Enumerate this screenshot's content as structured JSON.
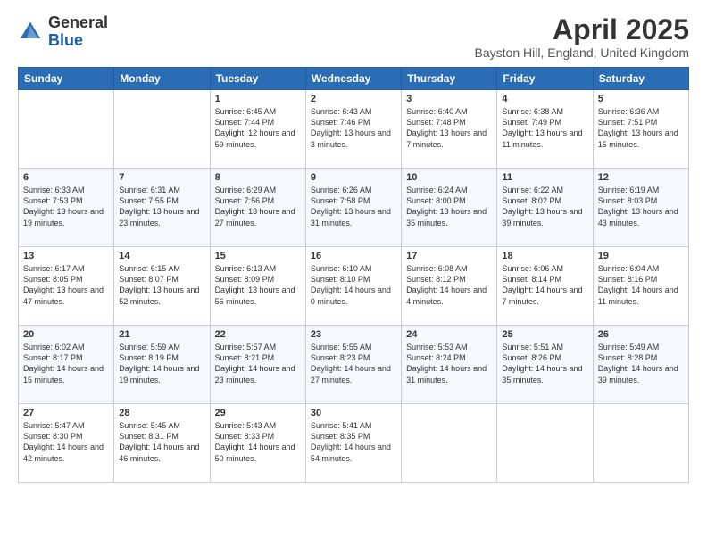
{
  "header": {
    "logo_general": "General",
    "logo_blue": "Blue",
    "month_title": "April 2025",
    "location": "Bayston Hill, England, United Kingdom"
  },
  "days_of_week": [
    "Sunday",
    "Monday",
    "Tuesday",
    "Wednesday",
    "Thursday",
    "Friday",
    "Saturday"
  ],
  "weeks": [
    [
      {
        "day": "",
        "info": ""
      },
      {
        "day": "",
        "info": ""
      },
      {
        "day": "1",
        "info": "Sunrise: 6:45 AM\nSunset: 7:44 PM\nDaylight: 12 hours and 59 minutes."
      },
      {
        "day": "2",
        "info": "Sunrise: 6:43 AM\nSunset: 7:46 PM\nDaylight: 13 hours and 3 minutes."
      },
      {
        "day": "3",
        "info": "Sunrise: 6:40 AM\nSunset: 7:48 PM\nDaylight: 13 hours and 7 minutes."
      },
      {
        "day": "4",
        "info": "Sunrise: 6:38 AM\nSunset: 7:49 PM\nDaylight: 13 hours and 11 minutes."
      },
      {
        "day": "5",
        "info": "Sunrise: 6:36 AM\nSunset: 7:51 PM\nDaylight: 13 hours and 15 minutes."
      }
    ],
    [
      {
        "day": "6",
        "info": "Sunrise: 6:33 AM\nSunset: 7:53 PM\nDaylight: 13 hours and 19 minutes."
      },
      {
        "day": "7",
        "info": "Sunrise: 6:31 AM\nSunset: 7:55 PM\nDaylight: 13 hours and 23 minutes."
      },
      {
        "day": "8",
        "info": "Sunrise: 6:29 AM\nSunset: 7:56 PM\nDaylight: 13 hours and 27 minutes."
      },
      {
        "day": "9",
        "info": "Sunrise: 6:26 AM\nSunset: 7:58 PM\nDaylight: 13 hours and 31 minutes."
      },
      {
        "day": "10",
        "info": "Sunrise: 6:24 AM\nSunset: 8:00 PM\nDaylight: 13 hours and 35 minutes."
      },
      {
        "day": "11",
        "info": "Sunrise: 6:22 AM\nSunset: 8:02 PM\nDaylight: 13 hours and 39 minutes."
      },
      {
        "day": "12",
        "info": "Sunrise: 6:19 AM\nSunset: 8:03 PM\nDaylight: 13 hours and 43 minutes."
      }
    ],
    [
      {
        "day": "13",
        "info": "Sunrise: 6:17 AM\nSunset: 8:05 PM\nDaylight: 13 hours and 47 minutes."
      },
      {
        "day": "14",
        "info": "Sunrise: 6:15 AM\nSunset: 8:07 PM\nDaylight: 13 hours and 52 minutes."
      },
      {
        "day": "15",
        "info": "Sunrise: 6:13 AM\nSunset: 8:09 PM\nDaylight: 13 hours and 56 minutes."
      },
      {
        "day": "16",
        "info": "Sunrise: 6:10 AM\nSunset: 8:10 PM\nDaylight: 14 hours and 0 minutes."
      },
      {
        "day": "17",
        "info": "Sunrise: 6:08 AM\nSunset: 8:12 PM\nDaylight: 14 hours and 4 minutes."
      },
      {
        "day": "18",
        "info": "Sunrise: 6:06 AM\nSunset: 8:14 PM\nDaylight: 14 hours and 7 minutes."
      },
      {
        "day": "19",
        "info": "Sunrise: 6:04 AM\nSunset: 8:16 PM\nDaylight: 14 hours and 11 minutes."
      }
    ],
    [
      {
        "day": "20",
        "info": "Sunrise: 6:02 AM\nSunset: 8:17 PM\nDaylight: 14 hours and 15 minutes."
      },
      {
        "day": "21",
        "info": "Sunrise: 5:59 AM\nSunset: 8:19 PM\nDaylight: 14 hours and 19 minutes."
      },
      {
        "day": "22",
        "info": "Sunrise: 5:57 AM\nSunset: 8:21 PM\nDaylight: 14 hours and 23 minutes."
      },
      {
        "day": "23",
        "info": "Sunrise: 5:55 AM\nSunset: 8:23 PM\nDaylight: 14 hours and 27 minutes."
      },
      {
        "day": "24",
        "info": "Sunrise: 5:53 AM\nSunset: 8:24 PM\nDaylight: 14 hours and 31 minutes."
      },
      {
        "day": "25",
        "info": "Sunrise: 5:51 AM\nSunset: 8:26 PM\nDaylight: 14 hours and 35 minutes."
      },
      {
        "day": "26",
        "info": "Sunrise: 5:49 AM\nSunset: 8:28 PM\nDaylight: 14 hours and 39 minutes."
      }
    ],
    [
      {
        "day": "27",
        "info": "Sunrise: 5:47 AM\nSunset: 8:30 PM\nDaylight: 14 hours and 42 minutes."
      },
      {
        "day": "28",
        "info": "Sunrise: 5:45 AM\nSunset: 8:31 PM\nDaylight: 14 hours and 46 minutes."
      },
      {
        "day": "29",
        "info": "Sunrise: 5:43 AM\nSunset: 8:33 PM\nDaylight: 14 hours and 50 minutes."
      },
      {
        "day": "30",
        "info": "Sunrise: 5:41 AM\nSunset: 8:35 PM\nDaylight: 14 hours and 54 minutes."
      },
      {
        "day": "",
        "info": ""
      },
      {
        "day": "",
        "info": ""
      },
      {
        "day": "",
        "info": ""
      }
    ]
  ]
}
